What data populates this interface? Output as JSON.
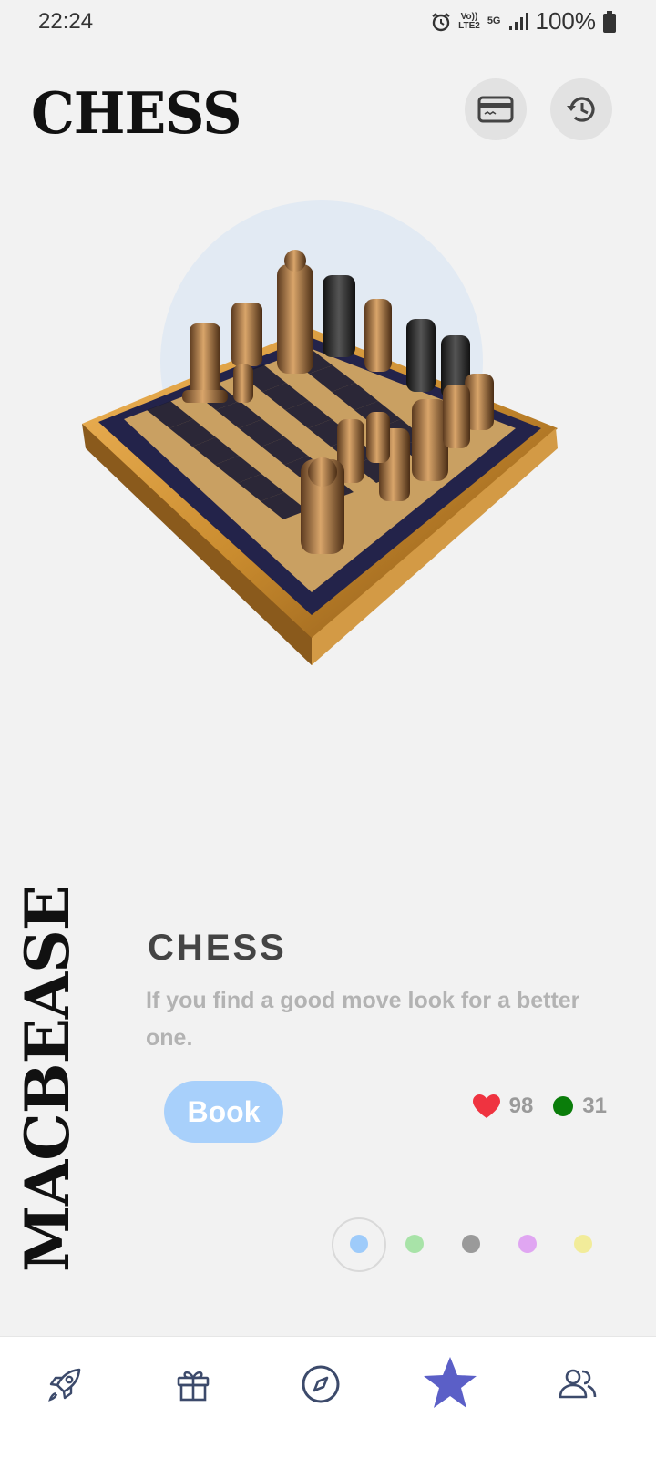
{
  "status_bar": {
    "time": "22:24",
    "network_lte": "Vo) LTE2",
    "network_5g": "5G",
    "battery": "100%"
  },
  "header": {
    "title": "CHESS",
    "card_button_icon": "card-icon",
    "history_button_icon": "history-icon"
  },
  "brand": {
    "vertical_text": "MACBEASE"
  },
  "card": {
    "title": "CHESS",
    "quote": "If you find a good move look for a better one.",
    "book_label": "Book",
    "likes": "98",
    "online": "31"
  },
  "pager": {
    "colors": [
      "#9ecbfa",
      "#a8e3a8",
      "#9a9a9a",
      "#e0a6f2",
      "#f2ec9a"
    ],
    "active_index": 0
  },
  "bottom_nav": {
    "items": [
      "rocket-icon",
      "gift-icon",
      "compass-icon",
      "star-icon",
      "people-icon"
    ],
    "active_index": 3,
    "active_color": "#5b5fc7",
    "inactive_color": "#3c4a6b"
  },
  "colors": {
    "accent": "#a8d0fb",
    "heart": "#ef3340",
    "online": "#0a7d0a"
  }
}
